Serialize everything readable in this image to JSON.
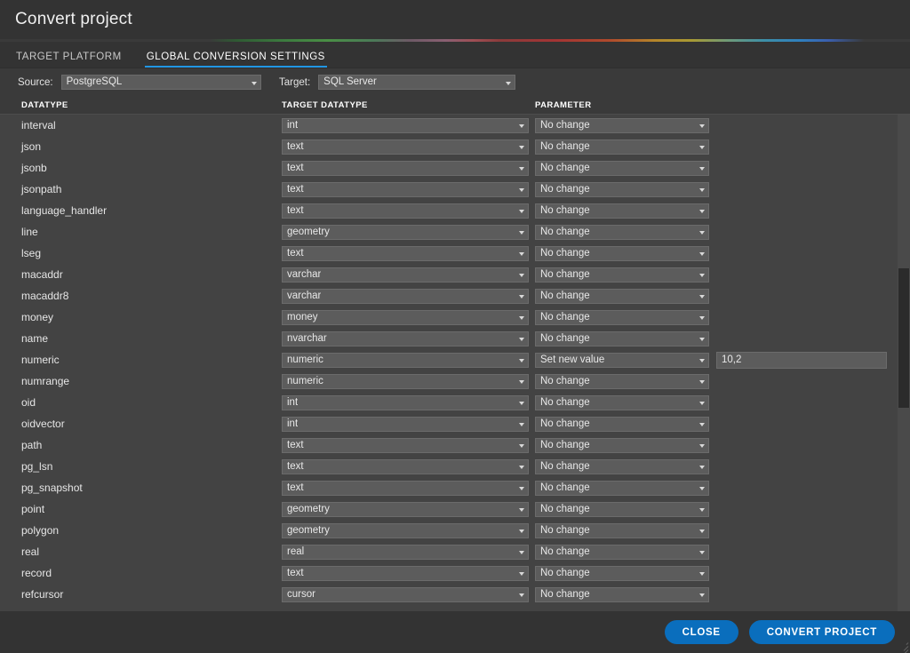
{
  "window": {
    "title": "Convert project"
  },
  "tabs": [
    {
      "label": "TARGET PLATFORM",
      "active": false
    },
    {
      "label": "GLOBAL CONVERSION SETTINGS",
      "active": true
    }
  ],
  "selectors": {
    "source": {
      "label": "Source:",
      "value": "PostgreSQL"
    },
    "target": {
      "label": "Target:",
      "value": "SQL Server"
    }
  },
  "columns": {
    "datatype": "DATATYPE",
    "target_datatype": "TARGET DATATYPE",
    "parameter": "PARAMETER"
  },
  "rows": [
    {
      "datatype": "interval",
      "target": "int",
      "parameter": "No change"
    },
    {
      "datatype": "json",
      "target": "text",
      "parameter": "No change"
    },
    {
      "datatype": "jsonb",
      "target": "text",
      "parameter": "No change"
    },
    {
      "datatype": "jsonpath",
      "target": "text",
      "parameter": "No change"
    },
    {
      "datatype": "language_handler",
      "target": "text",
      "parameter": "No change"
    },
    {
      "datatype": "line",
      "target": "geometry",
      "parameter": "No change"
    },
    {
      "datatype": "lseg",
      "target": "text",
      "parameter": "No change"
    },
    {
      "datatype": "macaddr",
      "target": "varchar",
      "parameter": "No change"
    },
    {
      "datatype": "macaddr8",
      "target": "varchar",
      "parameter": "No change"
    },
    {
      "datatype": "money",
      "target": "money",
      "parameter": "No change"
    },
    {
      "datatype": "name",
      "target": "nvarchar",
      "parameter": "No change"
    },
    {
      "datatype": "numeric",
      "target": "numeric",
      "parameter": "Set new value",
      "value": "10,2"
    },
    {
      "datatype": "numrange",
      "target": "numeric",
      "parameter": "No change"
    },
    {
      "datatype": "oid",
      "target": "int",
      "parameter": "No change"
    },
    {
      "datatype": "oidvector",
      "target": "int",
      "parameter": "No change"
    },
    {
      "datatype": "path",
      "target": "text",
      "parameter": "No change"
    },
    {
      "datatype": "pg_lsn",
      "target": "text",
      "parameter": "No change"
    },
    {
      "datatype": "pg_snapshot",
      "target": "text",
      "parameter": "No change"
    },
    {
      "datatype": "point",
      "target": "geometry",
      "parameter": "No change"
    },
    {
      "datatype": "polygon",
      "target": "geometry",
      "parameter": "No change"
    },
    {
      "datatype": "real",
      "target": "real",
      "parameter": "No change"
    },
    {
      "datatype": "record",
      "target": "text",
      "parameter": "No change"
    },
    {
      "datatype": "refcursor",
      "target": "cursor",
      "parameter": "No change"
    }
  ],
  "footer": {
    "close_label": "CLOSE",
    "convert_label": "CONVERT PROJECT"
  },
  "colors": {
    "accent": "#2196e3",
    "button": "#0a6ebd",
    "dialog_bg": "#333333",
    "panel_bg": "#434343",
    "bar_bg": "#3a3a3a",
    "control_bg": "#5c5c5c",
    "text": "#e6e6e6"
  },
  "scrollbar": {
    "thumb_top_pct": 31,
    "thumb_height_pct": 28
  }
}
